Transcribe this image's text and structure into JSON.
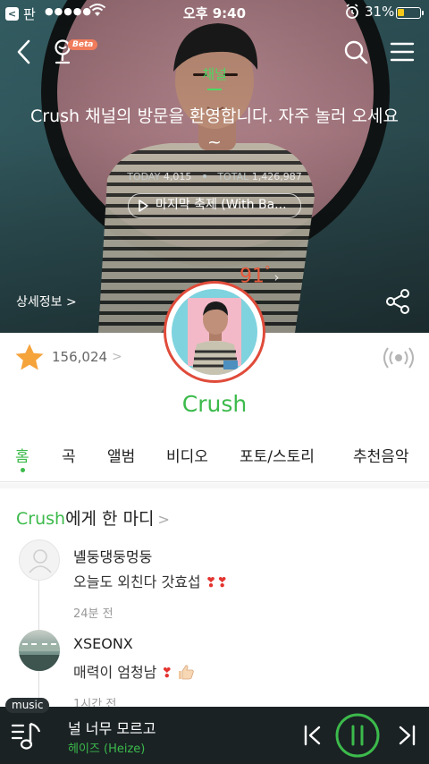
{
  "status_bar": {
    "back_app": "판",
    "signal": "●●●●●",
    "time": "오후 9:40",
    "battery_pct": "31%",
    "battery_level": 0.31
  },
  "nav": {
    "beta_badge": "Beta"
  },
  "hero": {
    "section_label": "채널",
    "welcome": "Crush 채널의 방문을 환영합니다. 자주 놀러 오세요~",
    "today_label": "TODAY",
    "today_value": "4,015",
    "total_label": "TOTAL",
    "total_value": "1,426,987",
    "song_pill": "마지막 축제 (With Ba...",
    "temperature": "91",
    "temperature_unit": "°",
    "detail_link": "상세정보 >"
  },
  "fans": {
    "count": "156,024",
    "chevron": ">"
  },
  "artist": {
    "name": "Crush"
  },
  "tabs": [
    {
      "label": "홈",
      "active": true
    },
    {
      "label": "곡"
    },
    {
      "label": "앨범"
    },
    {
      "label": "비디오"
    },
    {
      "label": "포토/스토리"
    },
    {
      "label": "추천음악"
    }
  ],
  "comments": {
    "title_artist": "Crush",
    "title_suffix": "에게 한 마디",
    "chevron": ">",
    "items": [
      {
        "user": "녤둥댕둥멍둥",
        "text": "오늘도 외친다 갓효섭",
        "time": "24분 전"
      },
      {
        "user": "XSEONX",
        "text": "매력이 엄청남",
        "time": "1시간 전"
      }
    ]
  },
  "player": {
    "tag": "music",
    "title": "널 너무 모르고",
    "artist": "헤이즈 (Heize)"
  },
  "colors": {
    "accent": "#3cba4b",
    "temperature": "#e75a3b",
    "player_bg": "#1a2224"
  }
}
